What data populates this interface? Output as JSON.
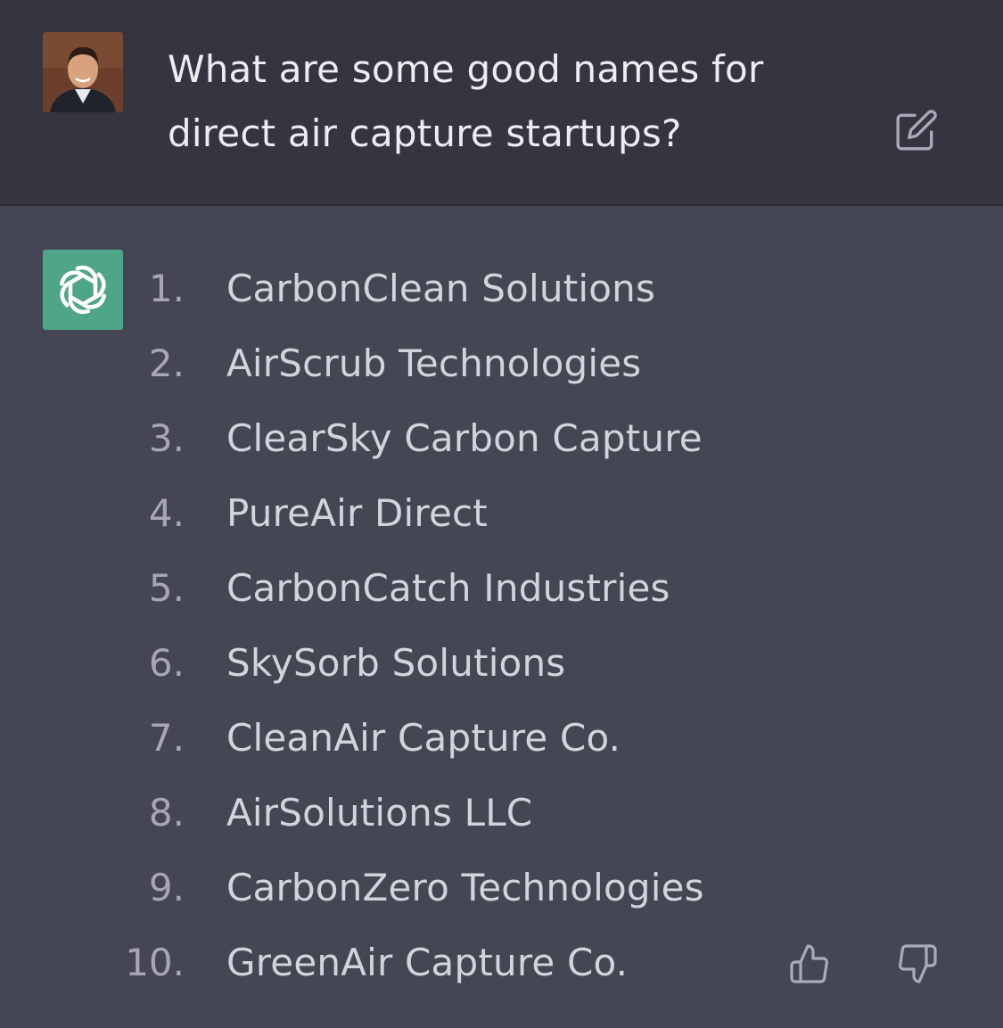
{
  "user_message": {
    "line1": "What are some good names for",
    "line2": "direct air capture startups?"
  },
  "icons": {
    "edit": "edit-pencil-icon",
    "assistant": "openai-logo-icon",
    "thumbs_up": "thumbs-up-icon",
    "thumbs_down": "thumbs-down-icon"
  },
  "colors": {
    "user_bg": "#343541",
    "assistant_bg": "#444654",
    "assistant_avatar": "#4fa587"
  },
  "assistant_response": {
    "items": [
      {
        "num": "1.",
        "text": "CarbonClean Solutions"
      },
      {
        "num": "2.",
        "text": "AirScrub Technologies"
      },
      {
        "num": "3.",
        "text": "ClearSky Carbon Capture"
      },
      {
        "num": "4.",
        "text": "PureAir Direct"
      },
      {
        "num": "5.",
        "text": "CarbonCatch Industries"
      },
      {
        "num": "6.",
        "text": "SkySorb Solutions"
      },
      {
        "num": "7.",
        "text": "CleanAir Capture Co."
      },
      {
        "num": "8.",
        "text": "AirSolutions LLC"
      },
      {
        "num": "9.",
        "text": "CarbonZero Technologies"
      },
      {
        "num": "10.",
        "text": "GreenAir Capture Co."
      }
    ]
  }
}
